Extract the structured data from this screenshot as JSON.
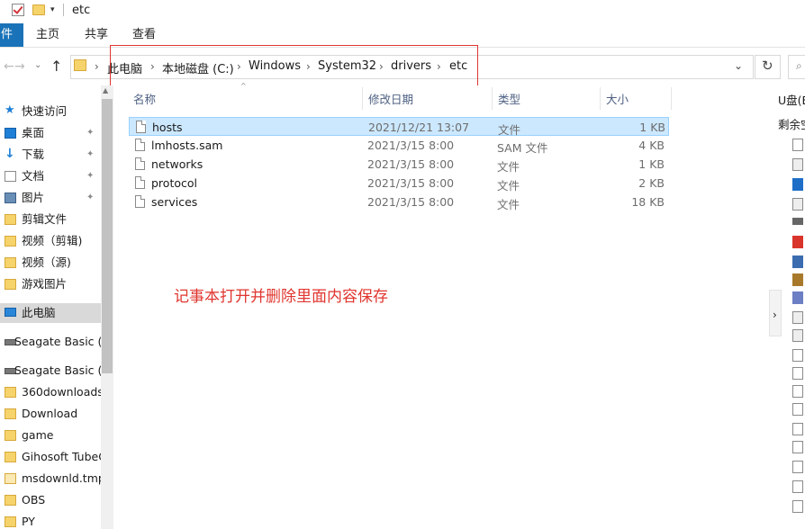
{
  "window": {
    "title": "etc"
  },
  "ribbon": {
    "file_tab": "件",
    "tabs": [
      "主页",
      "共享",
      "查看"
    ]
  },
  "address": {
    "breadcrumbs": [
      "此电脑",
      "本地磁盘 (C:)",
      "Windows",
      "System32",
      "drivers",
      "etc"
    ]
  },
  "columns": {
    "name": "名称",
    "modified": "修改日期",
    "type": "类型",
    "size": "大小"
  },
  "files": [
    {
      "name": "hosts",
      "modified": "2021/12/21 13:07",
      "type": "文件",
      "size": "1 KB",
      "selected": true
    },
    {
      "name": "lmhosts.sam",
      "modified": "2021/3/15 8:00",
      "type": "SAM 文件",
      "size": "4 KB"
    },
    {
      "name": "networks",
      "modified": "2021/3/15 8:00",
      "type": "文件",
      "size": "1 KB"
    },
    {
      "name": "protocol",
      "modified": "2021/3/15 8:00",
      "type": "文件",
      "size": "2 KB"
    },
    {
      "name": "services",
      "modified": "2021/3/15 8:00",
      "type": "文件",
      "size": "18 KB"
    }
  ],
  "sidebar": {
    "items": [
      {
        "label": "快速访问",
        "icon": "star-icon"
      },
      {
        "label": "桌面",
        "icon": "desktop-icon",
        "pinned": true
      },
      {
        "label": "下载",
        "icon": "download-icon",
        "pinned": true
      },
      {
        "label": "文档",
        "icon": "document-icon",
        "pinned": true
      },
      {
        "label": "图片",
        "icon": "picture-icon",
        "pinned": true
      },
      {
        "label": "剪辑文件",
        "icon": "folder-icon"
      },
      {
        "label": "视频（剪辑)",
        "icon": "folder-icon"
      },
      {
        "label": "视频（源)",
        "icon": "folder-icon"
      },
      {
        "label": "游戏图片",
        "icon": "folder-icon"
      },
      {
        "label": "此电脑",
        "icon": "pc-icon",
        "selected": true
      },
      {
        "label": "Seagate Basic (E",
        "icon": "drive-icon"
      },
      {
        "label": "Seagate Basic (F",
        "icon": "drive-icon"
      },
      {
        "label": "360downloads",
        "icon": "folder-icon"
      },
      {
        "label": "Download",
        "icon": "folder-icon"
      },
      {
        "label": "game",
        "icon": "folder-icon"
      },
      {
        "label": "Gihosoft TubeG",
        "icon": "folder-icon"
      },
      {
        "label": "msdownld.tmp",
        "icon": "folder-icon"
      },
      {
        "label": "OBS",
        "icon": "folder-icon"
      },
      {
        "label": "PY",
        "icon": "folder-icon"
      }
    ]
  },
  "annotation": {
    "text": "记事本打开并删除里面内容保存",
    "color": "#e0362f"
  },
  "preview": {
    "header": "U盘(E",
    "sub": "剩余空"
  }
}
